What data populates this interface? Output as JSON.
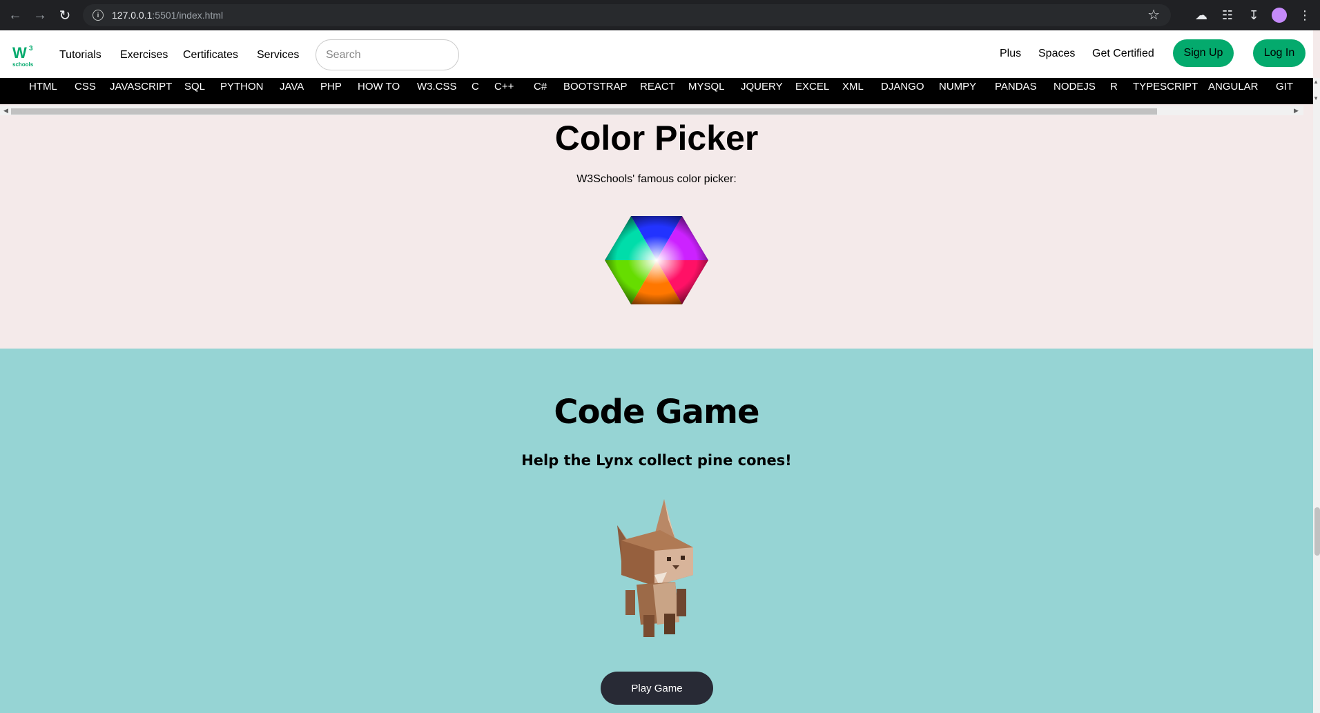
{
  "browser": {
    "url_host": "127.0.0.1",
    "url_path": ":5501/index.html"
  },
  "topnav": {
    "logo_text": "schools",
    "links": [
      "Tutorials",
      "Exercises",
      "Certificates",
      "Services"
    ],
    "search_placeholder": "Search",
    "right_links": [
      "Plus",
      "Spaces",
      "Get Certified"
    ],
    "signup_label": "Sign Up",
    "login_label": "Log In"
  },
  "subjects": [
    "HTML",
    "CSS",
    "JAVASCRIPT",
    "SQL",
    "PYTHON",
    "JAVA",
    "PHP",
    "HOW TO",
    "W3.CSS",
    "C",
    "C++",
    "C#",
    "BOOTSTRAP",
    "REACT",
    "MYSQL",
    "JQUERY",
    "EXCEL",
    "XML",
    "DJANGO",
    "NUMPY",
    "PANDAS",
    "NODEJS",
    "R",
    "TYPESCRIPT",
    "ANGULAR",
    "GIT"
  ],
  "color_picker": {
    "title": "Color Picker",
    "subtitle": "W3Schools' famous color picker:"
  },
  "code_game": {
    "title": "Code Game",
    "subtitle": "Help the Lynx collect pine cones!",
    "button_label": "Play Game"
  },
  "colors": {
    "brand_green": "#04aa6d",
    "section_pink": "#f4eaea",
    "section_teal": "#96d4d4",
    "dark_button": "#282a35"
  }
}
